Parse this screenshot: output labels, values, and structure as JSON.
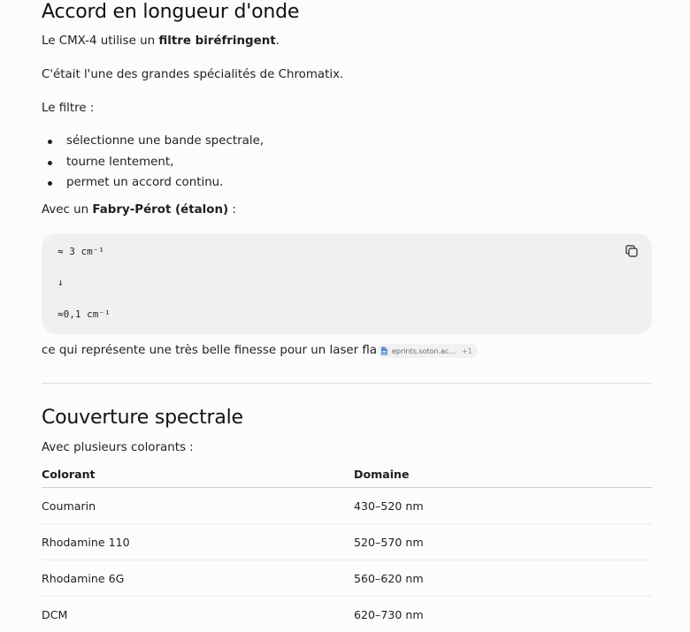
{
  "section1": {
    "title": "Accord en longueur d'onde",
    "p1_prefix": "Le CMX-4 utilise un ",
    "p1_bold": "filtre biréfringent",
    "p1_suffix": ".",
    "p2": "C'était l'une des grandes spécialités de Chromatix.",
    "p3": "Le filtre :",
    "bullets": [
      "sélectionne une bande spectrale,",
      "tourne lentement,",
      "permet un accord continu."
    ],
    "p4_prefix": "Avec un ",
    "p4_bold": "Fabry-Pérot (étalon)",
    "p4_suffix": " :",
    "code_lines": [
      "≈ 3 cm⁻¹",
      "↓",
      "≈0,1 cm⁻¹"
    ],
    "p5": "ce qui représente une très belle finesse pour un laser flash.",
    "source_chip": {
      "label": "eprints.soton.ac...",
      "extra": "+1",
      "icon": "document-icon"
    }
  },
  "section2": {
    "title": "Couverture spectrale",
    "intro": "Avec plusieurs colorants :",
    "table": {
      "headers": [
        "Colorant",
        "Domaine"
      ],
      "rows": [
        [
          "Coumarin",
          "430–520 nm"
        ],
        [
          "Rhodamine 110",
          "520–570 nm"
        ],
        [
          "Rhodamine 6G",
          "560–620 nm"
        ],
        [
          "DCM",
          "620–730 nm"
        ]
      ]
    }
  },
  "icons": {
    "copy": "copy-icon"
  },
  "colors": {
    "code_background": "#f0f0f0",
    "divider": "#dddddd",
    "text": "#1f1f1f"
  }
}
